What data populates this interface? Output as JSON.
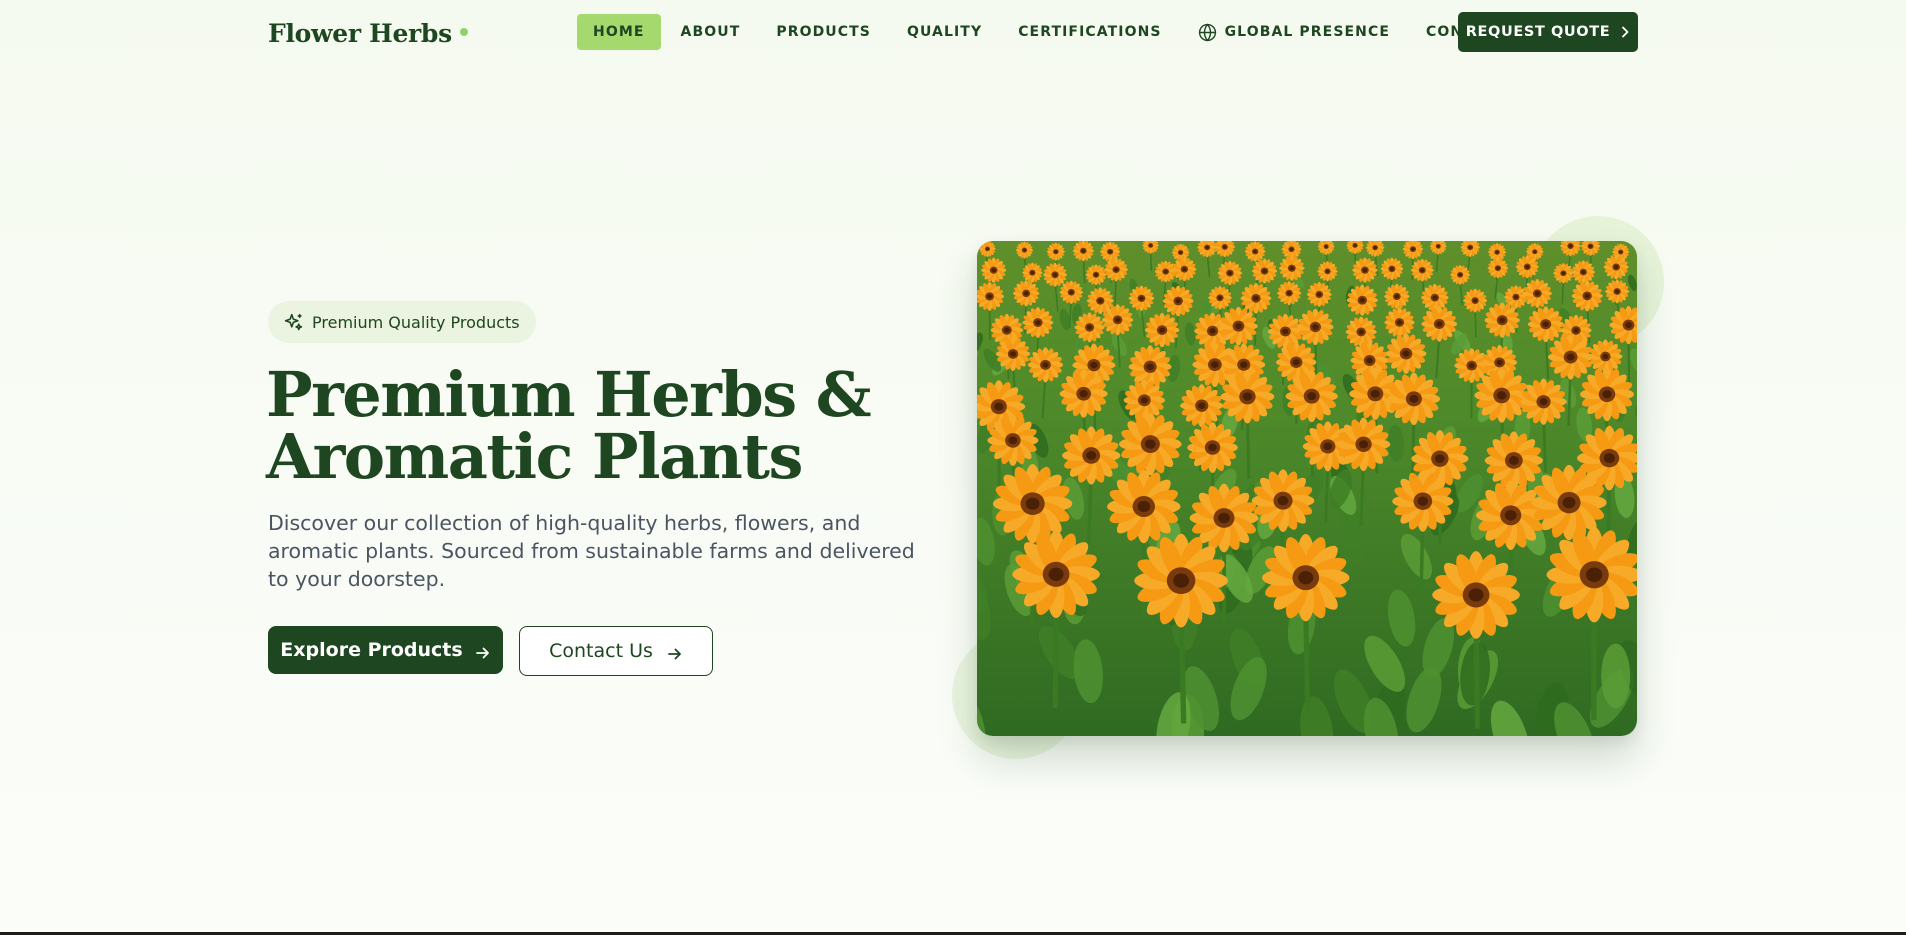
{
  "brand": {
    "name": "Flower Herbs",
    "accent": "#8fd16a",
    "primary": "#1e4620",
    "active_tab_bg": "#a5d96d"
  },
  "nav": {
    "items": [
      {
        "label": "HOME",
        "active": true
      },
      {
        "label": "ABOUT",
        "active": false
      },
      {
        "label": "PRODUCTS",
        "active": false
      },
      {
        "label": "QUALITY",
        "active": false
      },
      {
        "label": "CERTIFICATIONS",
        "active": false
      },
      {
        "label": "GLOBAL PRESENCE",
        "active": false,
        "icon": "globe-icon"
      },
      {
        "label": "CONTACT",
        "active": false
      }
    ],
    "cta": {
      "label": "REQUEST QUOTE",
      "icon": "chevron-right-icon"
    }
  },
  "hero": {
    "badge": {
      "label": "Premium Quality Products",
      "icon": "sparkle-icon"
    },
    "title_line1": "Premium Herbs &",
    "title_line2": "Aromatic Plants",
    "description": "Discover our collection of high-quality herbs, flowers, and aromatic plants. Sourced from sustainable farms and delivered to your doorstep.",
    "primary_button": {
      "label": "Explore Products",
      "icon": "arrow-right-icon"
    },
    "secondary_button": {
      "label": "Contact Us",
      "icon": "arrow-right-icon"
    },
    "image": {
      "subject": "field of orange calendula flowers",
      "icon": "flower-field-image"
    }
  }
}
